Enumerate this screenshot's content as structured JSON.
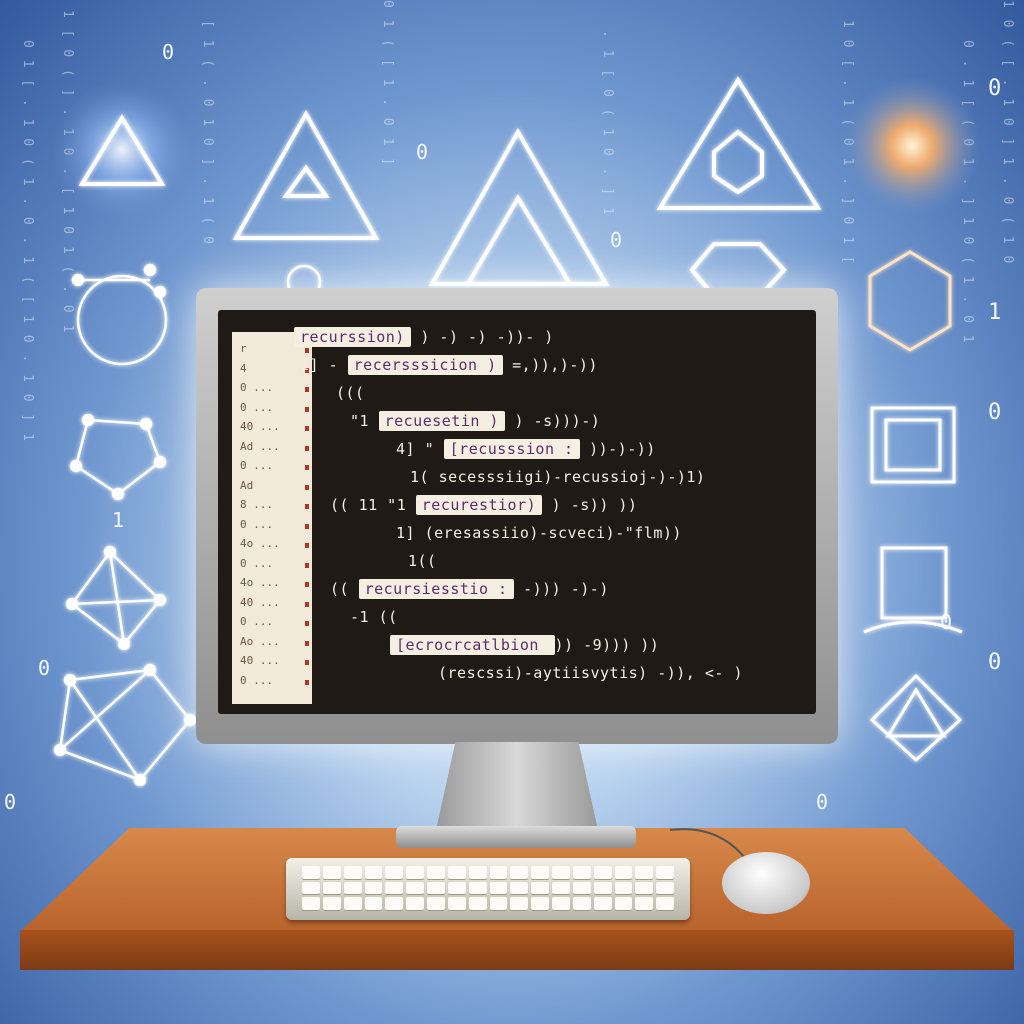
{
  "code_lines": [
    {
      "pre": "",
      "kw": "recurssion)",
      "post": " ) -) -) -))- )"
    },
    {
      "pre": "1] - ",
      "kw": "recersssicion )",
      "post": " =,)),)-))"
    },
    {
      "pre": "((( ",
      "kw": "",
      "post": ""
    },
    {
      "pre": "\"1 ",
      "kw": "recuesetin )",
      "post": " ) -s)))-)"
    },
    {
      "pre": "4] \" ",
      "kw": "[recusssion :",
      "post": " ))-)-))"
    },
    {
      "pre": "1( ",
      "kw": "",
      "post": "secesssiigi)-recussioj-)-)1)"
    },
    {
      "pre": "(( 11 \"1 ",
      "kw": "recurestior)",
      "post": " ) -s)) ))"
    },
    {
      "pre": "1] ",
      "kw": "",
      "post": "(eresassiio)-scveci)-\"flm))"
    },
    {
      "pre": "1((",
      "kw": "",
      "post": ""
    },
    {
      "pre": "(( ",
      "kw": "recursiesstio :",
      "post": " -))) -)-)"
    },
    {
      "pre": "-1 ((",
      "kw": "",
      "post": ""
    },
    {
      "pre": "",
      "kw": "[ecrocrcatlbion ",
      "post": " )) -9))) ))"
    },
    {
      "pre": "",
      "kw": "",
      "post": "(rescssi)-aytiisvytis) -)), <- )"
    }
  ],
  "gutter_numbers": [
    "r",
    "4",
    "0 ...",
    "0 ...",
    "40 ...",
    "Ad ...",
    "0 ...",
    "Ad",
    "8 ...",
    "0 ...",
    "4o ...",
    "0 ...",
    "4o ...",
    "40 ...",
    "0 ...",
    "Ao ...",
    "40 ...",
    "0 ..."
  ],
  "binary_digits": [
    "0",
    "0",
    "0",
    "0",
    "1",
    "0",
    "0",
    "0",
    "1",
    "0",
    "0",
    "0"
  ],
  "colors": {
    "accent": "#5b2d6b",
    "screen": "#1f1a15",
    "desk": "#b8622c"
  }
}
